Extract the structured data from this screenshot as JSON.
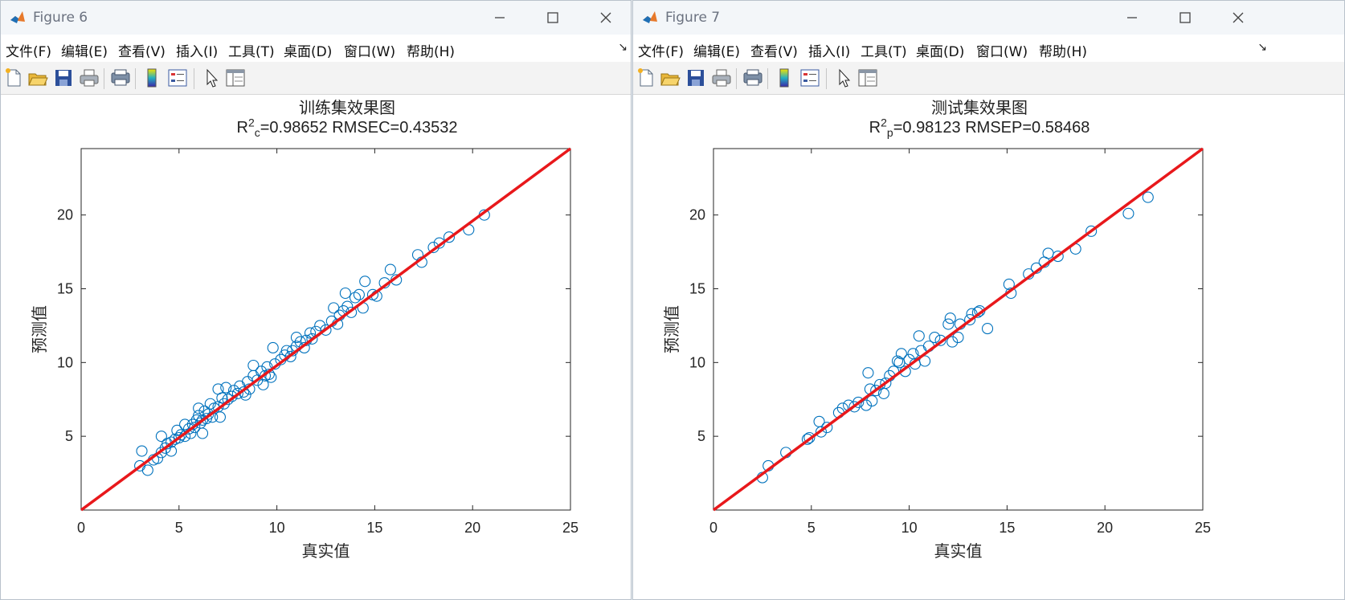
{
  "menu": [
    "文件(F)",
    "编辑(E)",
    "查看(V)",
    "插入(I)",
    "工具(T)",
    "桌面(D)",
    "窗口(W)",
    "帮助(H)"
  ],
  "toolbar_icons": [
    "new-figure-icon",
    "open-file-icon",
    "save-icon",
    "print-icon",
    "print-preview-icon",
    "colorbar-icon",
    "legend-icon",
    "select-cursor-icon",
    "property-editor-icon"
  ],
  "windows": [
    {
      "title": "Figure 6",
      "chart_title": "训练集效果图",
      "metric_label": "R",
      "metric_sup": "2",
      "metric_sub": "c",
      "metric_rest": "=0.98652  RMSEC=0.43532"
    },
    {
      "title": "Figure 7",
      "chart_title": "测试集效果图",
      "metric_label": "R",
      "metric_sup": "2",
      "metric_sub": "p",
      "metric_rest": "=0.98123  RMSEP=0.58468"
    }
  ],
  "chart_data": [
    {
      "type": "scatter",
      "title": "训练集效果图",
      "subtitle": "R_c^2=0.98652  RMSEC=0.43532",
      "xlabel": "真实值",
      "ylabel": "预测值",
      "xlim": [
        0,
        25
      ],
      "ylim": [
        0,
        24.5
      ],
      "xticks": [
        0,
        5,
        10,
        15,
        20,
        25
      ],
      "yticks": [
        5,
        10,
        15,
        20
      ],
      "grid": false,
      "marker_color": "#0072bd",
      "line_color": "#e8181b",
      "fit_line": {
        "x": [
          0,
          25
        ],
        "y": [
          0,
          24.5
        ]
      },
      "points": [
        [
          3.0,
          3.0
        ],
        [
          3.1,
          4.0
        ],
        [
          3.4,
          2.7
        ],
        [
          3.7,
          3.4
        ],
        [
          3.9,
          3.5
        ],
        [
          4.1,
          3.9
        ],
        [
          4.1,
          5.0
        ],
        [
          4.3,
          4.2
        ],
        [
          4.4,
          4.5
        ],
        [
          4.6,
          4.0
        ],
        [
          4.6,
          4.6
        ],
        [
          4.8,
          4.8
        ],
        [
          4.9,
          5.4
        ],
        [
          5.0,
          4.9
        ],
        [
          5.1,
          5.1
        ],
        [
          5.3,
          5.0
        ],
        [
          5.3,
          5.8
        ],
        [
          5.5,
          5.5
        ],
        [
          5.6,
          5.2
        ],
        [
          5.7,
          5.8
        ],
        [
          5.8,
          5.6
        ],
        [
          5.9,
          6.1
        ],
        [
          6.0,
          6.4
        ],
        [
          6.0,
          6.9
        ],
        [
          6.1,
          5.9
        ],
        [
          6.2,
          5.2
        ],
        [
          6.2,
          6.1
        ],
        [
          6.3,
          6.7
        ],
        [
          6.4,
          6.2
        ],
        [
          6.5,
          6.5
        ],
        [
          6.6,
          7.2
        ],
        [
          6.7,
          6.3
        ],
        [
          6.8,
          6.9
        ],
        [
          7.0,
          7.0
        ],
        [
          7.0,
          8.2
        ],
        [
          7.1,
          6.3
        ],
        [
          7.2,
          7.6
        ],
        [
          7.3,
          7.2
        ],
        [
          7.4,
          8.3
        ],
        [
          7.5,
          7.5
        ],
        [
          7.7,
          7.7
        ],
        [
          7.8,
          8.1
        ],
        [
          8.0,
          7.9
        ],
        [
          8.1,
          8.4
        ],
        [
          8.3,
          8.0
        ],
        [
          8.4,
          7.8
        ],
        [
          8.5,
          8.7
        ],
        [
          8.6,
          8.2
        ],
        [
          8.8,
          9.1
        ],
        [
          8.8,
          9.8
        ],
        [
          9.0,
          8.8
        ],
        [
          9.2,
          9.4
        ],
        [
          9.3,
          8.5
        ],
        [
          9.4,
          9.1
        ],
        [
          9.5,
          9.7
        ],
        [
          9.6,
          9.2
        ],
        [
          9.7,
          9.0
        ],
        [
          9.8,
          11.0
        ],
        [
          9.9,
          9.9
        ],
        [
          10.2,
          10.2
        ],
        [
          10.4,
          10.5
        ],
        [
          10.5,
          10.8
        ],
        [
          10.7,
          10.4
        ],
        [
          10.8,
          10.8
        ],
        [
          11.0,
          11.1
        ],
        [
          11.0,
          11.7
        ],
        [
          11.2,
          11.4
        ],
        [
          11.4,
          11.0
        ],
        [
          11.5,
          11.5
        ],
        [
          11.7,
          12.0
        ],
        [
          11.8,
          11.6
        ],
        [
          12.0,
          12.1
        ],
        [
          12.2,
          12.5
        ],
        [
          12.5,
          12.2
        ],
        [
          12.8,
          12.8
        ],
        [
          12.9,
          13.7
        ],
        [
          13.1,
          12.6
        ],
        [
          13.2,
          13.2
        ],
        [
          13.4,
          13.5
        ],
        [
          13.5,
          14.7
        ],
        [
          13.6,
          13.8
        ],
        [
          13.8,
          13.4
        ],
        [
          14.0,
          14.4
        ],
        [
          14.2,
          14.6
        ],
        [
          14.4,
          13.7
        ],
        [
          14.5,
          15.5
        ],
        [
          14.9,
          14.6
        ],
        [
          15.1,
          14.5
        ],
        [
          15.5,
          15.4
        ],
        [
          15.8,
          16.3
        ],
        [
          16.1,
          15.6
        ],
        [
          17.2,
          17.3
        ],
        [
          17.4,
          16.8
        ],
        [
          18.0,
          17.8
        ],
        [
          18.3,
          18.1
        ],
        [
          18.8,
          18.5
        ],
        [
          19.8,
          19.0
        ],
        [
          20.6,
          20.0
        ]
      ]
    },
    {
      "type": "scatter",
      "title": "测试集效果图",
      "subtitle": "R_p^2=0.98123  RMSEP=0.58468",
      "xlabel": "真实值",
      "ylabel": "预测值",
      "xlim": [
        0,
        25
      ],
      "ylim": [
        0,
        24.5
      ],
      "xticks": [
        0,
        5,
        10,
        15,
        20,
        25
      ],
      "yticks": [
        5,
        10,
        15,
        20
      ],
      "grid": false,
      "marker_color": "#0072bd",
      "line_color": "#e8181b",
      "fit_line": {
        "x": [
          0,
          25
        ],
        "y": [
          0,
          24.5
        ]
      },
      "points": [
        [
          2.5,
          2.2
        ],
        [
          2.8,
          3.0
        ],
        [
          3.7,
          3.9
        ],
        [
          4.8,
          4.8
        ],
        [
          4.9,
          4.9
        ],
        [
          5.4,
          6.0
        ],
        [
          5.5,
          5.3
        ],
        [
          5.8,
          5.6
        ],
        [
          6.4,
          6.6
        ],
        [
          6.6,
          6.9
        ],
        [
          6.9,
          7.1
        ],
        [
          7.2,
          7.0
        ],
        [
          7.4,
          7.3
        ],
        [
          7.8,
          7.1
        ],
        [
          7.9,
          9.3
        ],
        [
          8.0,
          8.2
        ],
        [
          8.1,
          7.4
        ],
        [
          8.3,
          8.1
        ],
        [
          8.5,
          8.5
        ],
        [
          8.7,
          7.9
        ],
        [
          8.8,
          8.6
        ],
        [
          9.0,
          9.1
        ],
        [
          9.2,
          9.4
        ],
        [
          9.4,
          10.1
        ],
        [
          9.5,
          10.0
        ],
        [
          9.6,
          10.6
        ],
        [
          9.8,
          9.4
        ],
        [
          10.0,
          10.2
        ],
        [
          10.2,
          10.6
        ],
        [
          10.3,
          9.9
        ],
        [
          10.5,
          11.8
        ],
        [
          10.6,
          10.8
        ],
        [
          10.8,
          10.1
        ],
        [
          11.0,
          11.1
        ],
        [
          11.3,
          11.7
        ],
        [
          11.6,
          11.5
        ],
        [
          12.0,
          12.6
        ],
        [
          12.1,
          13.0
        ],
        [
          12.2,
          11.4
        ],
        [
          12.5,
          11.7
        ],
        [
          12.6,
          12.6
        ],
        [
          13.1,
          12.9
        ],
        [
          13.2,
          13.3
        ],
        [
          13.5,
          13.4
        ],
        [
          13.6,
          13.5
        ],
        [
          14.0,
          12.3
        ],
        [
          15.1,
          15.3
        ],
        [
          15.2,
          14.7
        ],
        [
          16.1,
          16.0
        ],
        [
          16.5,
          16.4
        ],
        [
          16.9,
          16.8
        ],
        [
          17.1,
          17.4
        ],
        [
          17.6,
          17.2
        ],
        [
          18.5,
          17.7
        ],
        [
          19.3,
          18.9
        ],
        [
          21.2,
          20.1
        ],
        [
          22.2,
          21.2
        ]
      ]
    }
  ]
}
